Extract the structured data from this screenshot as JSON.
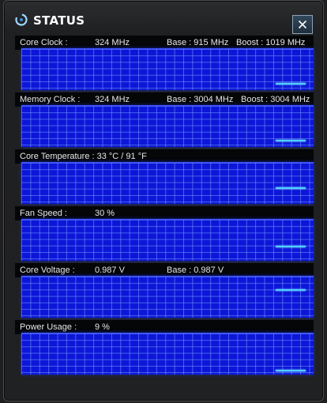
{
  "window": {
    "title": "STATUS",
    "close_symbol": "×"
  },
  "colors": {
    "graph_bg": "#0d16d8",
    "grid": "#7aa0ff",
    "trace": "#4fd2ff",
    "header_bg": "#050608"
  },
  "panels": [
    {
      "label": "Core Clock :",
      "value": "324 MHz",
      "base": "Base : 915 MHz",
      "boost": "Boost : 1019 MHz"
    },
    {
      "label": "Memory Clock :",
      "value": "324 MHz",
      "base": "Base : 3004 MHz",
      "boost": "Boost : 3004 MHz"
    },
    {
      "label": "Core Temperature : 33 °C / 91 °F",
      "value": "",
      "base": "",
      "boost": ""
    },
    {
      "label": "Fan Speed :",
      "value": "30 %",
      "base": "",
      "boost": ""
    },
    {
      "label": "Core Voltage :",
      "value": "0.987 V",
      "base": "Base : 0.987 V",
      "boost": ""
    },
    {
      "label": "Power Usage :",
      "value": "9 %",
      "base": "",
      "boost": ""
    }
  ]
}
